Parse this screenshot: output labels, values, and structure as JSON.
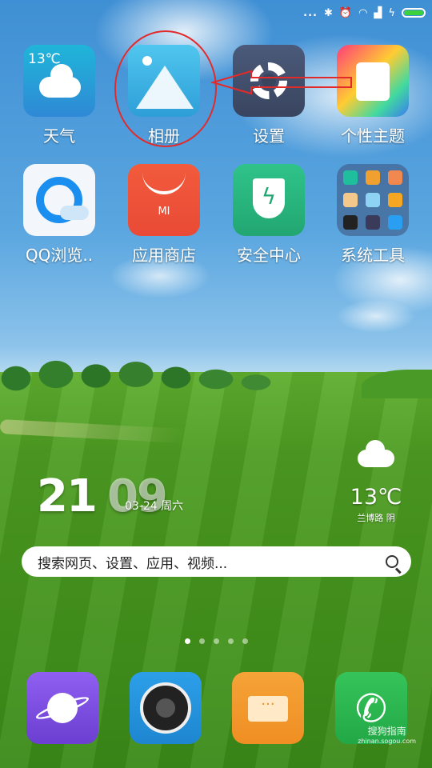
{
  "status_bar": {
    "dots": "...",
    "bluetooth_icon": "bluetooth-icon",
    "alarm_icon": "alarm-icon",
    "wifi_icon": "wifi-icon",
    "signal_icon": "signal-icon",
    "charging_icon": "charging-bolt-icon",
    "battery_color": "#3dd13d"
  },
  "apps_row1": [
    {
      "label": "天气",
      "icon": "weather-icon",
      "temp": "13℃"
    },
    {
      "label": "相册",
      "icon": "gallery-icon"
    },
    {
      "label": "设置",
      "icon": "settings-gear-icon"
    },
    {
      "label": "个性主题",
      "icon": "theme-shirt-icon"
    }
  ],
  "apps_row2": [
    {
      "label": "QQ浏览..",
      "icon": "qq-browser-icon"
    },
    {
      "label": "应用商店",
      "icon": "app-store-icon",
      "brand": "MI"
    },
    {
      "label": "安全中心",
      "icon": "security-shield-icon"
    },
    {
      "label": "系统工具",
      "icon": "folder-icon"
    }
  ],
  "clock_widget": {
    "hour": "21",
    "minute": "09",
    "date": "03-24 周六"
  },
  "weather_widget": {
    "temp": "13℃",
    "location": "兰博路 阴",
    "icon": "cloud-icon"
  },
  "search": {
    "placeholder": "搜索网页、设置、应用、视频...",
    "icon": "search-icon"
  },
  "pager": {
    "pages": 5,
    "active": 0
  },
  "dock": [
    {
      "name": "explore-planet-icon"
    },
    {
      "name": "camera-icon"
    },
    {
      "name": "messages-icon",
      "text": "···"
    },
    {
      "name": "phone-icon"
    }
  ],
  "watermark": {
    "text": "搜狗指南",
    "sub": "zhinan.sogou.com"
  },
  "annotation": {
    "color": "#e32a2a"
  }
}
